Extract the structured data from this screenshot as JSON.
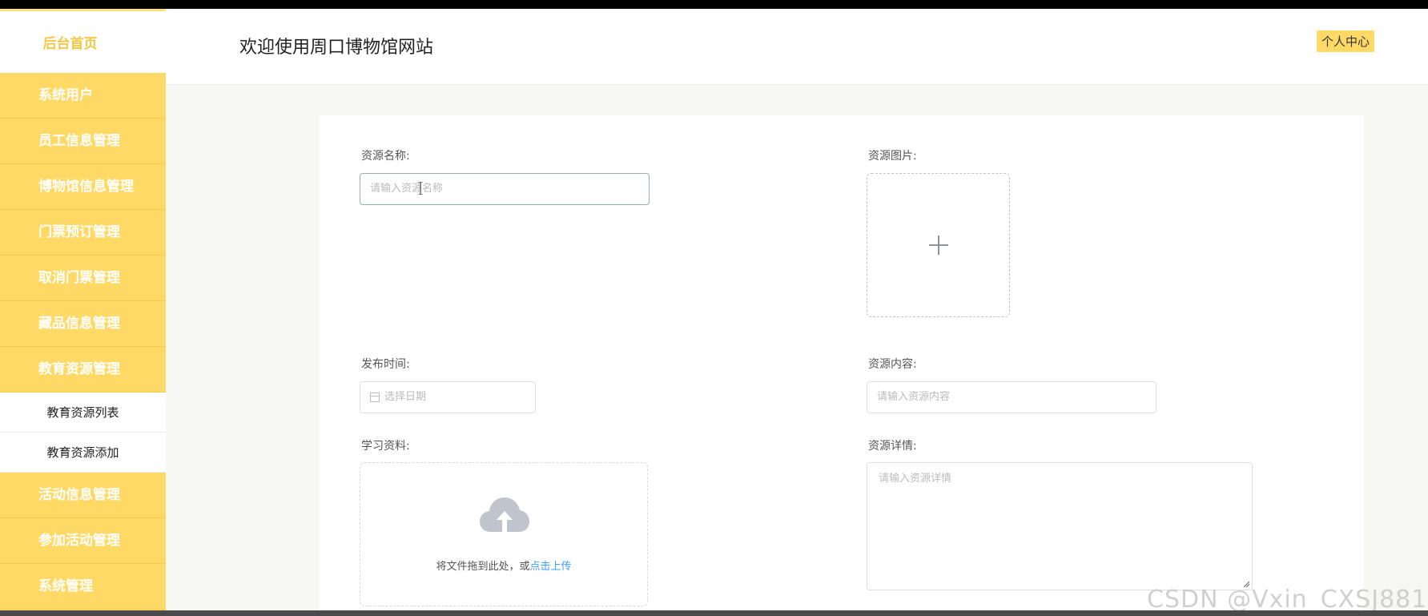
{
  "header": {
    "title": "欢迎使用周口博物馆网站",
    "user_center": "个人中心"
  },
  "sidebar": {
    "home": "后台首页",
    "items": [
      {
        "label": "系统用户"
      },
      {
        "label": "员工信息管理"
      },
      {
        "label": "博物馆信息管理"
      },
      {
        "label": "门票预订管理"
      },
      {
        "label": "取消门票管理"
      },
      {
        "label": "藏品信息管理"
      },
      {
        "label": "教育资源管理"
      }
    ],
    "sub_items": [
      {
        "label": "教育资源列表"
      },
      {
        "label": "教育资源添加"
      }
    ],
    "items_after": [
      {
        "label": "活动信息管理"
      },
      {
        "label": "参加活动管理"
      },
      {
        "label": "系统管理"
      }
    ]
  },
  "form": {
    "name_label": "资源名称:",
    "name_placeholder": "请输入资源名称",
    "image_label": "资源图片:",
    "date_label": "发布时间:",
    "date_placeholder": "选择日期",
    "content_label": "资源内容:",
    "content_placeholder": "请输入资源内容",
    "material_label": "学习资料:",
    "upload_text": "将文件拖到此处，或",
    "upload_link": "点击上传",
    "detail_label": "资源详情:",
    "detail_placeholder": "请输入资源详情"
  },
  "watermark": "CSDN @Vxin_CXSJ881",
  "colors": {
    "accent": "#ffd966",
    "link": "#409eff"
  }
}
